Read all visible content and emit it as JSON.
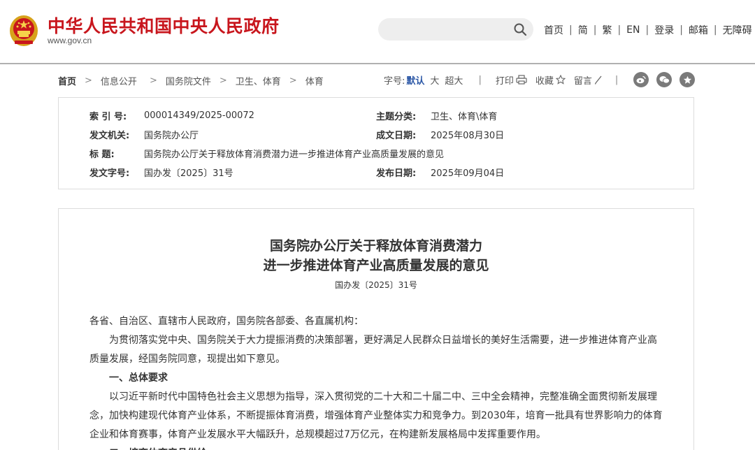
{
  "header": {
    "title": "中华人民共和国中央人民政府",
    "url": "www.gov.cn",
    "search_placeholder": "",
    "nav": [
      "首页",
      "简",
      "繁",
      "EN",
      "登录",
      "邮箱",
      "无障碍"
    ],
    "nav_separator": "|"
  },
  "breadcrumb": {
    "items": [
      "首页",
      "信息公开",
      "国务院文件",
      "卫生、体育",
      "体育"
    ],
    "arrow": ">"
  },
  "tools": {
    "font_label": "字号:",
    "font_default": "默认",
    "font_large": "大",
    "font_xlarge": "超大",
    "divider": "|",
    "print": "打印",
    "favorite": "收藏",
    "comment": "留言"
  },
  "meta": {
    "index_label": "索 引 号:",
    "index_value": "000014349/2025-00072",
    "topic_label": "主题分类:",
    "topic_value": "卫生、体育\\体育",
    "issuer_label": "发文机关:",
    "issuer_value": "国务院办公厅",
    "date_label": "成文日期:",
    "date_value": "2025年08月30日",
    "title_label": "标 题:",
    "title_value": "国务院办公厅关于释放体育消费潜力进一步推进体育产业高质量发展的意见",
    "docno_label": "发文字号:",
    "docno_value": "国办发〔2025〕31号",
    "pubdate_label": "发布日期:",
    "pubdate_value": "2025年09月04日"
  },
  "article": {
    "title_line1": "国务院办公厅关于释放体育消费潜力",
    "title_line2": "进一步推进体育产业高质量发展的意见",
    "docno": "国办发〔2025〕31号",
    "salutation": "各省、自治区、直辖市人民政府，国务院各部委、各直属机构：",
    "intro": "为贯彻落实党中央、国务院关于大力提振消费的决策部署，更好满足人民群众日益增长的美好生活需要，进一步推进体育产业高质量发展，经国务院同意，现提出如下意见。",
    "section1": "一、总体要求",
    "para1": "以习近平新时代中国特色社会主义思想为指导，深入贯彻党的二十大和二十届二中、三中全会精神，完整准确全面贯彻新发展理念，加快构建现代体育产业体系，不断提振体育消费，增强体育产业整体实力和竞争力。到2030年，培育一批具有世界影响力的体育企业和体育赛事，体育产业发展水平大幅跃升，总规模超过7万亿元，在构建新发展格局中发挥重要作用。",
    "section2": "二、培育体育产品供给"
  },
  "colors": {
    "brand_red": "#c8161d",
    "accent_blue": "#2b57a6",
    "border": "#dcdcdc"
  }
}
